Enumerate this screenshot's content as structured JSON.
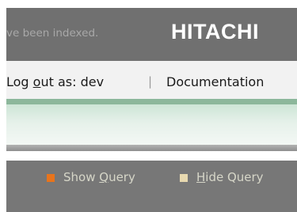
{
  "header": {
    "indexed_text": "ve been indexed.",
    "brand": "HITACHI"
  },
  "user_bar": {
    "logout_prefix": "Log ",
    "logout_accesskey": "o",
    "logout_suffix": "ut as: ",
    "username": "dev",
    "separator": "|",
    "documentation": "Documentation"
  },
  "query_bar": {
    "show_label_prefix": "Show ",
    "show_accesskey": "Q",
    "show_label_suffix": "uery",
    "hide_accesskey": "H",
    "hide_label_suffix": "ide Query"
  },
  "colors": {
    "show_bullet": "#e8741c",
    "hide_bullet": "#e8d9b0"
  }
}
